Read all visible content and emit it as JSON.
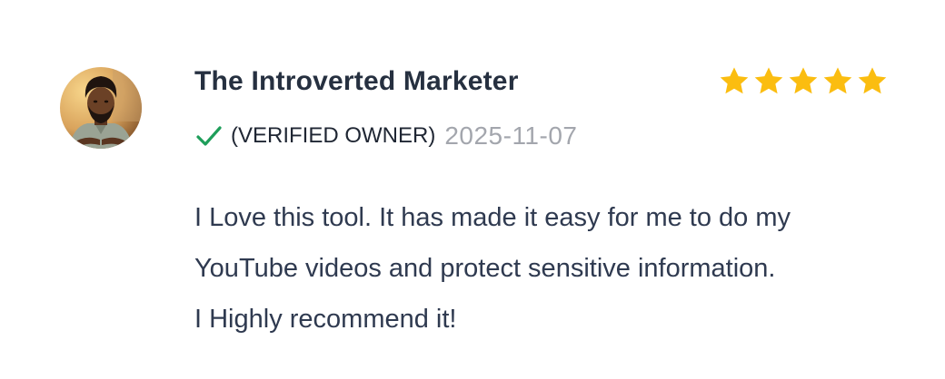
{
  "review": {
    "reviewer_name": "The Introverted Marketer",
    "rating": 5,
    "rating_max": 5,
    "verified_label": "(VERIFIED OWNER)",
    "date": "2025-11-07",
    "body_lines": [
      "I Love this tool. It has made it easy for me to do my",
      "YouTube videos and protect sensitive information.",
      "I Highly recommend it!"
    ]
  },
  "icons": {
    "star": "star-icon",
    "check": "check-icon"
  },
  "colors": {
    "star": "#fbbd10",
    "check": "#1e9e5a",
    "name": "#263040",
    "date": "#a3a6ad",
    "body": "#2f3a50"
  }
}
